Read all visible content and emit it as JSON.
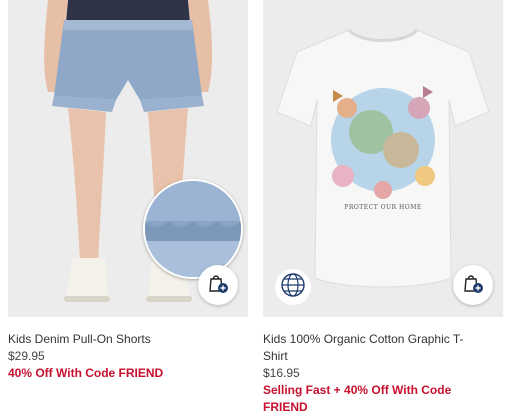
{
  "products": [
    {
      "name": "Kids Denim Pull-On Shorts",
      "price": "$29.95",
      "promo_lines": [
        "40% Off With Code FRIEND"
      ],
      "icon": "add-to-bag-icon"
    },
    {
      "name_lines": [
        "Kids 100% Organic Cotton Graphic T-",
        "Shirt"
      ],
      "price": "$16.95",
      "promo_lines": [
        "Selling Fast + 40% Off With Code",
        "FRIEND"
      ],
      "graphic_text": "PROTECT OUR HOME",
      "badge_icon": "globe-icon",
      "icon": "add-to-bag-icon"
    }
  ],
  "colors": {
    "promo": "#c8102e",
    "photo_bg": "#ececec",
    "accent": "#1f3b6e"
  }
}
